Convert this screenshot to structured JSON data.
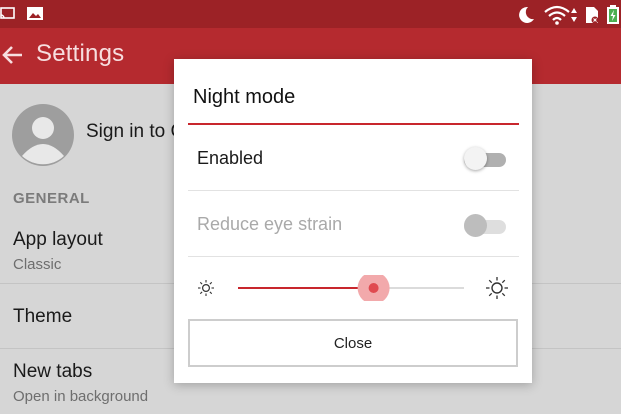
{
  "colors": {
    "status_bar": "#9c2226",
    "app_bar": "#b52a2f",
    "accent": "#c8262d",
    "slider_thumb": "#e04a50",
    "slider_halo": "#f2a9ab"
  },
  "status_bar": {
    "left_icons": [
      "cast-icon",
      "image-icon"
    ],
    "right_icons": [
      "moon-icon",
      "wifi-icon",
      "sim-icon",
      "battery-icon"
    ]
  },
  "app_bar": {
    "title": "Settings",
    "back_icon": "arrow-left-icon"
  },
  "settings": {
    "account": {
      "label": "Sign in to C",
      "icon": "avatar-icon"
    },
    "section_general": "GENERAL",
    "items": [
      {
        "title": "App layout",
        "subtitle": "Classic"
      },
      {
        "title": "Theme"
      },
      {
        "title": "New tabs",
        "subtitle": "Open in background"
      }
    ]
  },
  "dialog": {
    "title": "Night mode",
    "options": [
      {
        "label": "Enabled",
        "checked": false,
        "disabled": false
      },
      {
        "label": "Reduce eye strain",
        "checked": false,
        "disabled": true
      }
    ],
    "brightness": {
      "min_icon": "sun-small-icon",
      "max_icon": "sun-large-icon",
      "value": 0.6
    },
    "close_label": "Close"
  }
}
